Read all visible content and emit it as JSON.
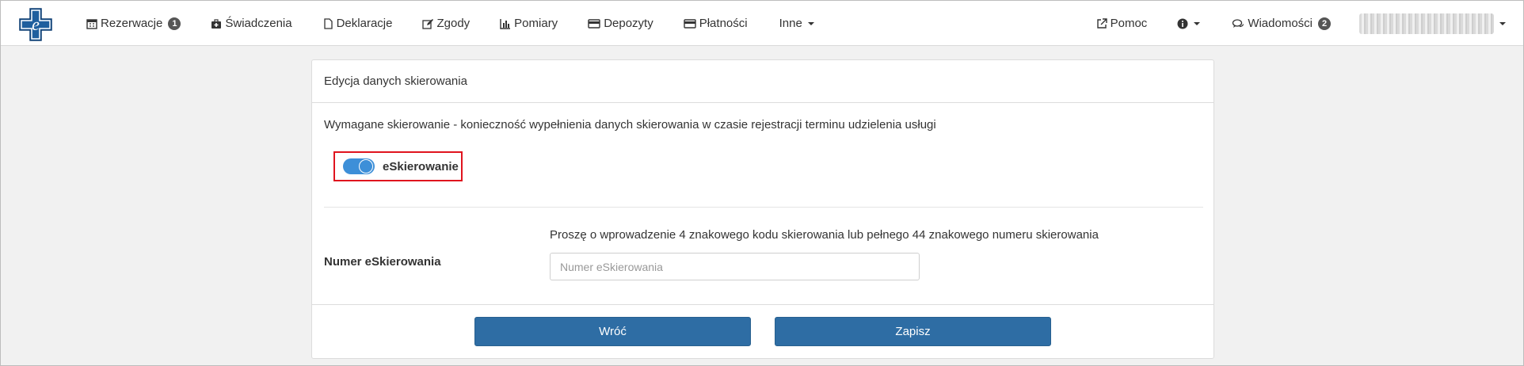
{
  "nav": {
    "left_items": [
      {
        "label": "Rezerwacje",
        "badge": "1",
        "icon": "calendar-icon"
      },
      {
        "label": "Świadczenia",
        "icon": "medkit-icon"
      },
      {
        "label": "Deklaracje",
        "icon": "file-icon"
      },
      {
        "label": "Zgody",
        "icon": "edit-icon"
      },
      {
        "label": "Pomiary",
        "icon": "bar-chart-icon"
      },
      {
        "label": "Depozyty",
        "icon": "card-icon"
      },
      {
        "label": "Płatności",
        "icon": "credit-card-icon"
      },
      {
        "label": "Inne",
        "icon": "caret-down-icon"
      }
    ],
    "right_items": [
      {
        "label": "Pomoc",
        "icon": "external-link-icon"
      },
      {
        "label": "",
        "icon": "info-icon"
      },
      {
        "label": "Wiadomości",
        "badge": "2",
        "icon": "comments-icon"
      }
    ]
  },
  "panel": {
    "heading": "Edycja danych skierowania",
    "info": "Wymagane skierowanie - konieczność wypełnienia danych skierowania w czasie rejestracji terminu udzielenia usługi",
    "toggle_label": "eSkierowanie",
    "toggle_on": true,
    "field_label": "Numer eSkierowania",
    "field_help": "Proszę o wprowadzenie 4 znakowego kodu skierowania lub pełnego 44 znakowego numeru skierowania",
    "field_placeholder": "Numer eSkierowania",
    "field_value": "",
    "back_label": "Wróć",
    "save_label": "Zapisz"
  },
  "colors": {
    "primary": "#2e6da4",
    "toggle": "#3d8fd8",
    "highlight": "#e0141e",
    "logo": "#1f5f9e"
  }
}
